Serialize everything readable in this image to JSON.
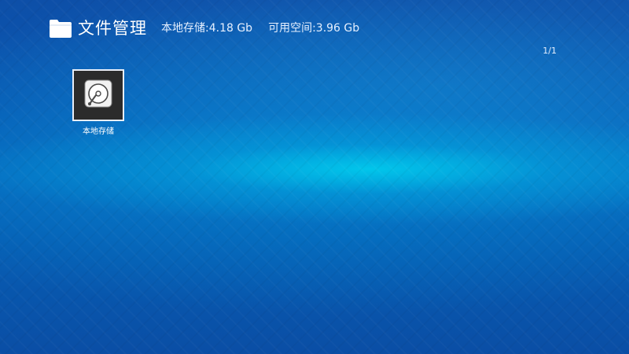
{
  "header": {
    "folder_icon": "folder-icon",
    "title": "文件管理",
    "local_storage": "本地存储:4.18 Gb",
    "available_space": "可用空间:3.96 Gb"
  },
  "pagination": {
    "indicator": "1/1"
  },
  "items": [
    {
      "label": "本地存储",
      "icon": "hard-drive-icon"
    }
  ],
  "colors": {
    "background": "#0a5ab4",
    "highlight": "#00c8ec",
    "tile_background": "#2b2b2b",
    "tile_border": "#e8eef8"
  }
}
